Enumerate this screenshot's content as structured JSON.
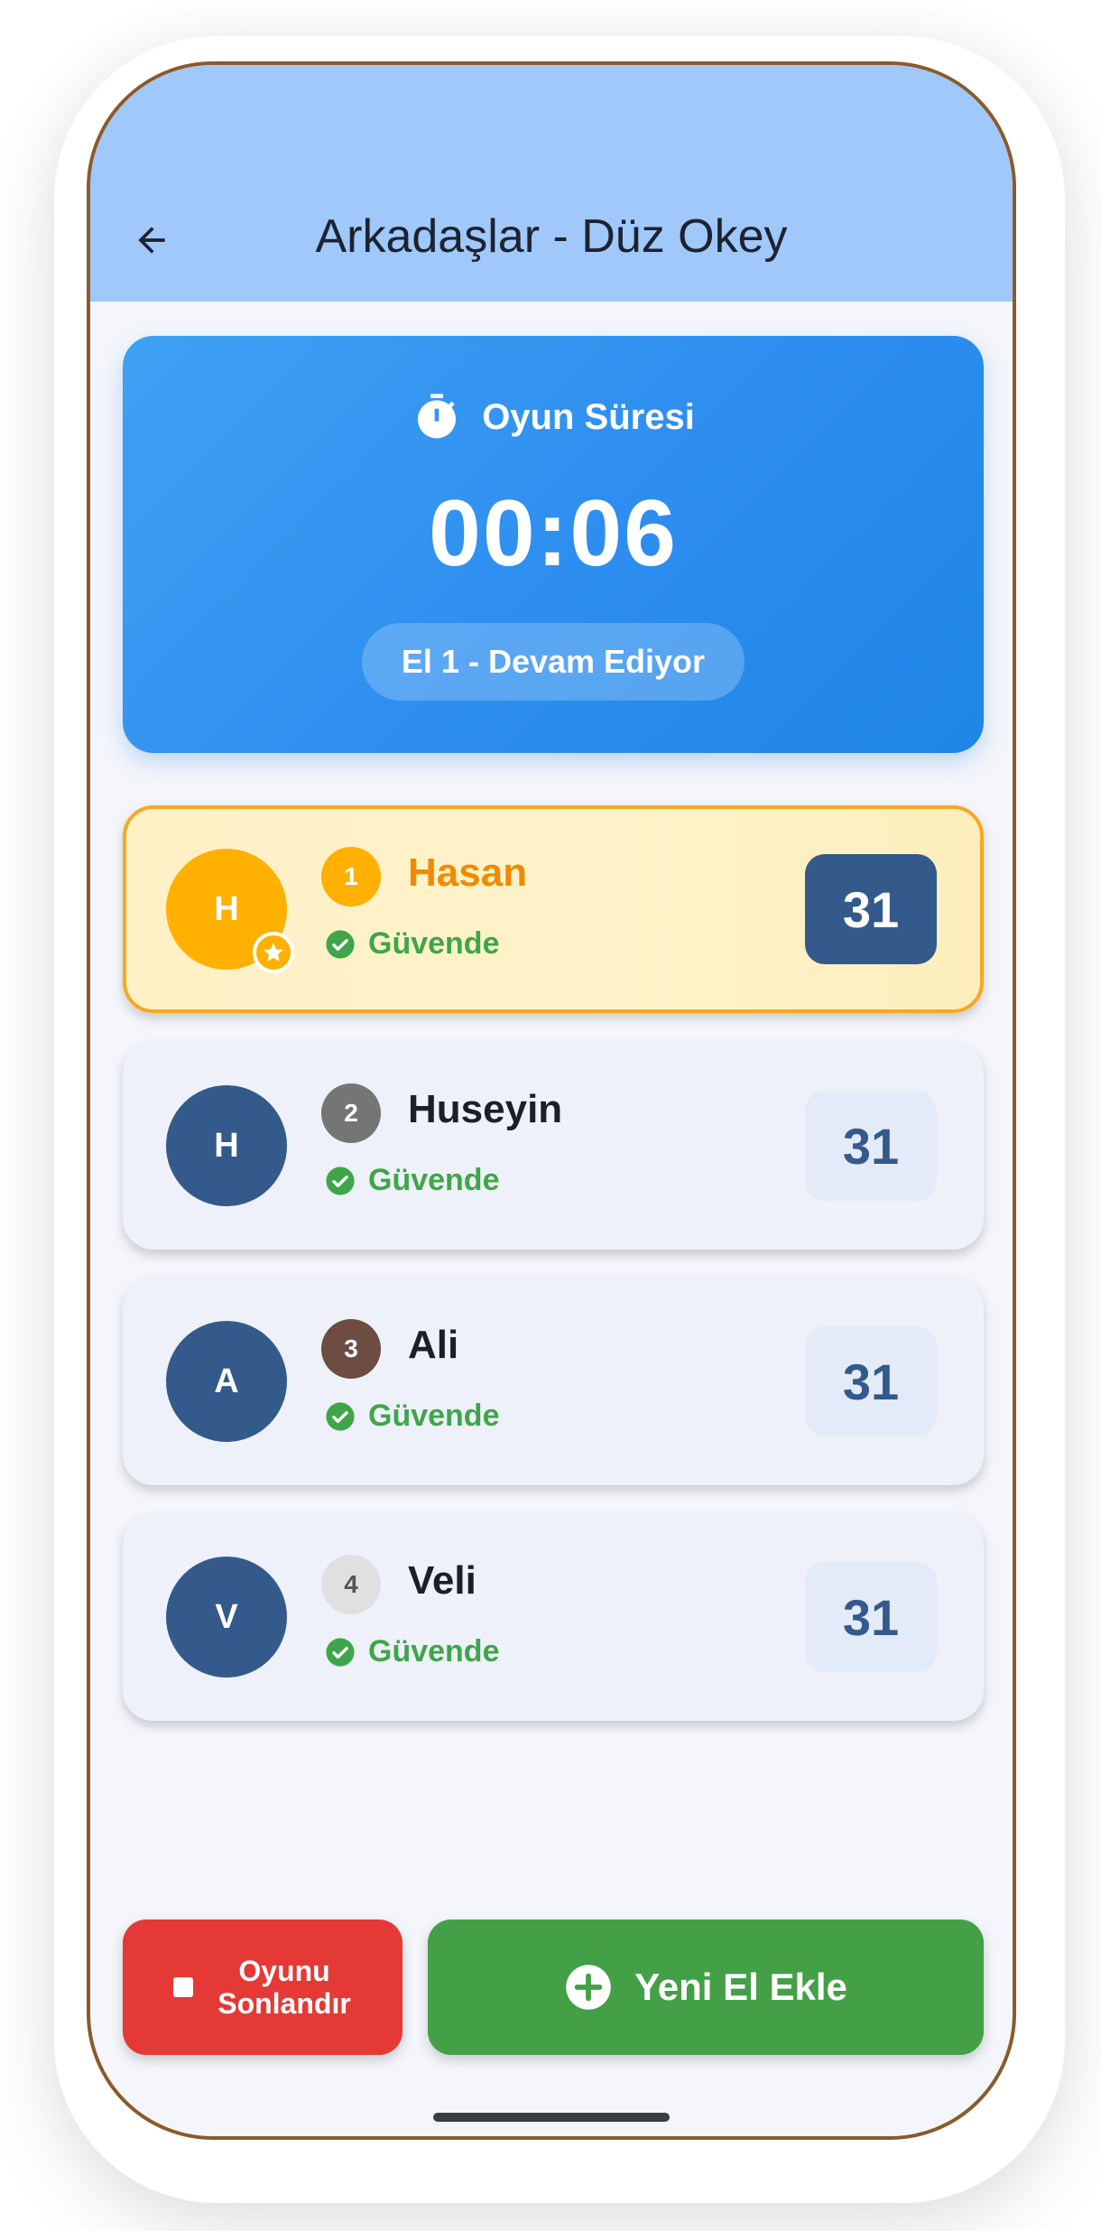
{
  "appbar": {
    "title": "Arkadaşlar - Düz Okey",
    "back_icon": "arrow-left-icon"
  },
  "timer": {
    "label": "Oyun Süresi",
    "icon": "stopwatch-icon",
    "value": "00:06",
    "round_status": "El 1 - Devam Ediyor"
  },
  "players": [
    {
      "initial": "H",
      "rank": "1",
      "name": "Hasan",
      "status": "Güvende",
      "score": "31",
      "leader": true,
      "rank_color": "#ffb000"
    },
    {
      "initial": "H",
      "rank": "2",
      "name": "Huseyin",
      "status": "Güvende",
      "score": "31",
      "leader": false,
      "rank_color": "#757575"
    },
    {
      "initial": "A",
      "rank": "3",
      "name": "Ali",
      "status": "Güvende",
      "score": "31",
      "leader": false,
      "rank_color": "#6d4c41"
    },
    {
      "initial": "V",
      "rank": "4",
      "name": "Veli",
      "status": "Güvende",
      "score": "31",
      "leader": false,
      "rank_color": "#e0e0e0"
    }
  ],
  "actions": {
    "end_game_label": "Oyunu Sonlandır",
    "add_round_label": "Yeni El Ekle"
  },
  "colors": {
    "accent_blue": "#2f8ff0",
    "leader_gold": "#ffb000",
    "safe_green": "#3fa54a",
    "danger_red": "#e53935",
    "action_green": "#43a047"
  }
}
